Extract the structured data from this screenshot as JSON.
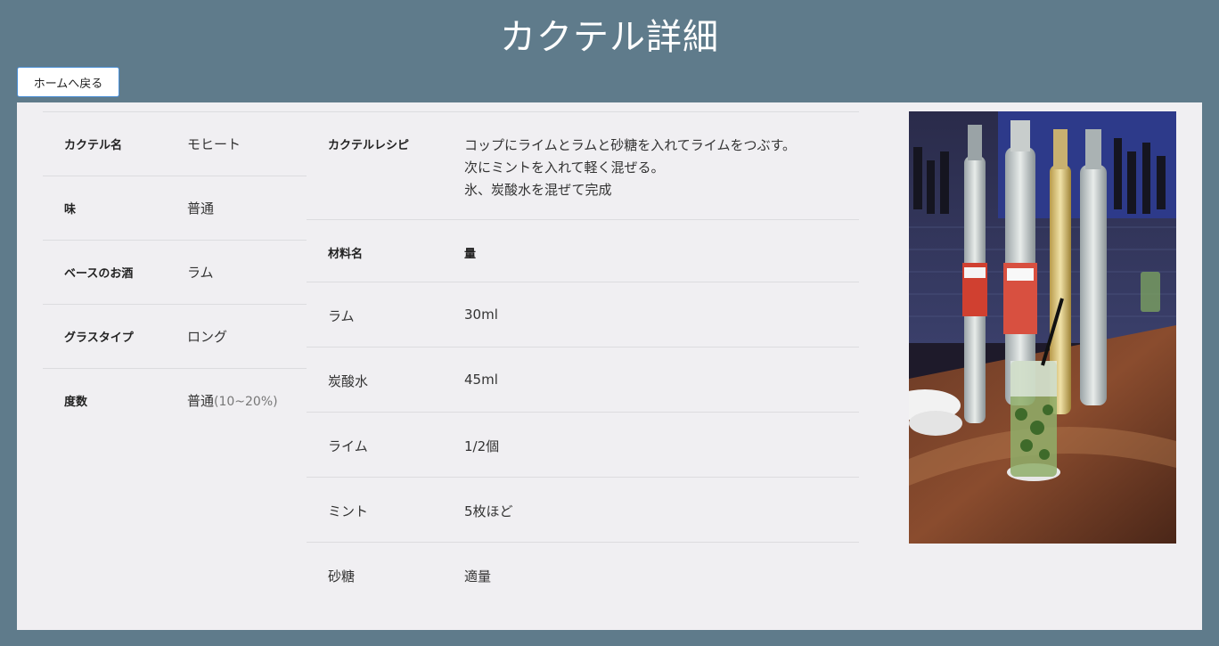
{
  "header": {
    "title": "カクテル詳細"
  },
  "nav": {
    "back_label": "ホームへ戻る"
  },
  "info": [
    {
      "label": "カクテル名",
      "value": "モヒート",
      "sub": ""
    },
    {
      "label": "味",
      "value": "普通",
      "sub": ""
    },
    {
      "label": "ベースのお酒",
      "value": "ラム",
      "sub": ""
    },
    {
      "label": "グラスタイプ",
      "value": "ロング",
      "sub": ""
    },
    {
      "label": "度数",
      "value": "普通",
      "sub": "(10~20%)"
    }
  ],
  "recipe": {
    "label": "カクテルレシピ",
    "lines": [
      "コップにライムとラムと砂糖を入れてライムをつぶす。",
      "次にミントを入れて軽く混ぜる。",
      "氷、炭酸水を混ぜて完成"
    ]
  },
  "ingredients": {
    "headers": {
      "name": "材料名",
      "amount": "量"
    },
    "rows": [
      {
        "name": "ラム",
        "amount": "30ml"
      },
      {
        "name": "炭酸水",
        "amount": "45ml"
      },
      {
        "name": "ライム",
        "amount": "1/2個"
      },
      {
        "name": "ミント",
        "amount": "5枚ほど"
      },
      {
        "name": "砂糖",
        "amount": "適量"
      }
    ]
  },
  "photo": {
    "subject": "mojito-with-rum-bottles-photo"
  }
}
